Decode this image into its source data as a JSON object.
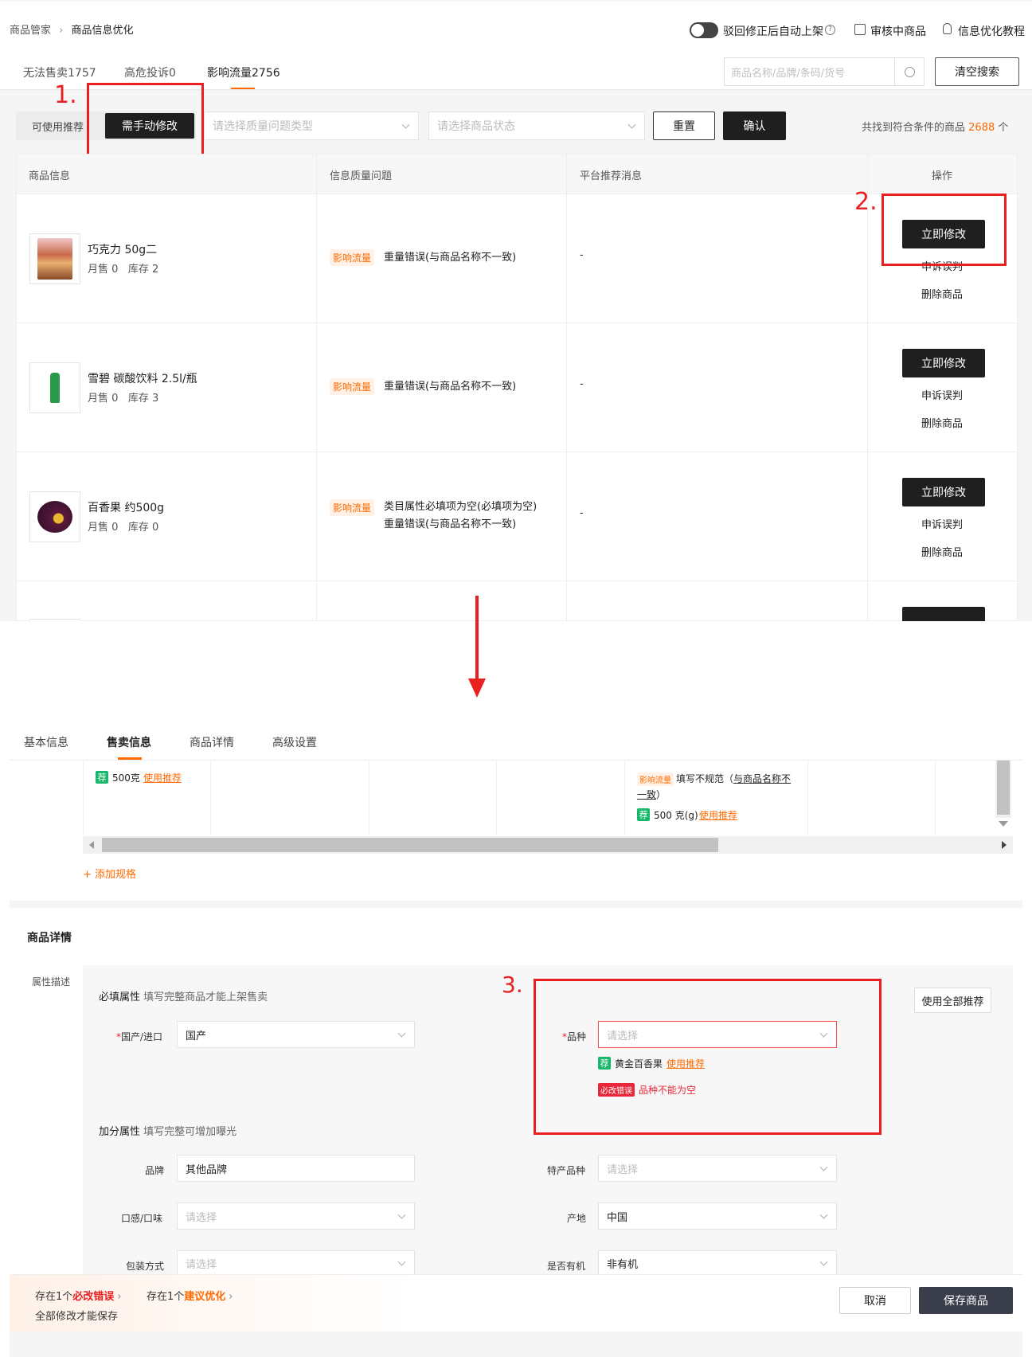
{
  "header": {
    "breadcrumb_root": "商品管家",
    "breadcrumb_current": "商品信息优化",
    "toggle_label": "驳回修正后自动上架",
    "review_link": "审核中商品",
    "tutorial_link": "信息优化教程"
  },
  "tabs": [
    {
      "label": "无法售卖1757"
    },
    {
      "label": "高危投诉0"
    },
    {
      "label": "影响流量2756"
    }
  ],
  "search": {
    "placeholder": "商品名称/品牌/条码/货号",
    "clear_label": "清空搜索"
  },
  "filter": {
    "seg_left": "可使用推荐",
    "seg_active": "需手动修改",
    "type_placeholder": "请选择质量问题类型",
    "status_placeholder": "请选择商品状态",
    "reset": "重置",
    "confirm": "确认",
    "result_prefix": "共找到符合条件的商品",
    "result_count": "2688",
    "result_suffix": "个"
  },
  "table": {
    "headers": [
      "商品信息",
      "信息质量问题",
      "平台推荐消息",
      "操作"
    ],
    "rows": [
      {
        "name": "巧克力 50g二",
        "sales": "月售 0",
        "stock": "库存 2",
        "tag": "影响流量",
        "issues": [
          "重量错误(与商品名称不一致)"
        ],
        "rec": "-"
      },
      {
        "name": "雪碧 碳酸饮料 2.5l/瓶",
        "sales": "月售 0",
        "stock": "库存 3",
        "tag": "影响流量",
        "issues": [
          "重量错误(与商品名称不一致)"
        ],
        "rec": "-"
      },
      {
        "name": "百香果 约500g",
        "sales": "月售 0",
        "stock": "库存 0",
        "tag": "影响流量",
        "issues": [
          "类目属性必填项为空(必填项为空)",
          "重量错误(与商品名称不一致)"
        ],
        "rec": "-"
      }
    ],
    "actions": {
      "modify": "立即修改",
      "appeal": "申诉误判",
      "delete": "删除商品"
    }
  },
  "annotations": {
    "step1": "1.",
    "step2": "2.",
    "step3": "3."
  },
  "editor": {
    "tabs": [
      "基本信息",
      "售卖信息",
      "商品详情",
      "高级设置"
    ],
    "spec": {
      "rec_badge": "荐",
      "rec1_value": "500克",
      "use_rec": "使用推荐",
      "tag": "影响流量",
      "warn_text": "填写不规范（",
      "warn_link1": "与商品名称不",
      "warn_link2": "一致",
      "warn_close": "）",
      "rec2_value": "500 克(g)",
      "add_spec": "+ 添加规格"
    },
    "detail_title": "商品详情",
    "attr_label": "属性描述",
    "use_all_rec": "使用全部推荐",
    "required_title": "必填属性",
    "required_hint": "填写完整商品才能上架售卖",
    "origin_label": "国产/进口",
    "origin_value": "国产",
    "variety_label": "品种",
    "variety_placeholder": "请选择",
    "variety_rec": "黄金百香果",
    "error_tag": "必改错误",
    "error_msg": "品种不能为空",
    "bonus_title": "加分属性",
    "bonus_hint": "填写完整可增加曝光",
    "brand_label": "品牌",
    "brand_value": "其他品牌",
    "special_label": "特产品种",
    "special_placeholder": "请选择",
    "taste_label": "口感/口味",
    "taste_placeholder": "请选择",
    "place_label": "产地",
    "place_value": "中国",
    "pack_label": "包装方式",
    "pack_placeholder": "请选择",
    "organic_label": "是否有机",
    "organic_value": "非有机",
    "footer": {
      "err_prefix": "存在1个",
      "err_word": "必改错误",
      "sug_prefix": "存在1个",
      "sug_word": "建议优化",
      "save_hint": "全部修改才能保存",
      "cancel": "取消",
      "save": "保存商品"
    }
  }
}
